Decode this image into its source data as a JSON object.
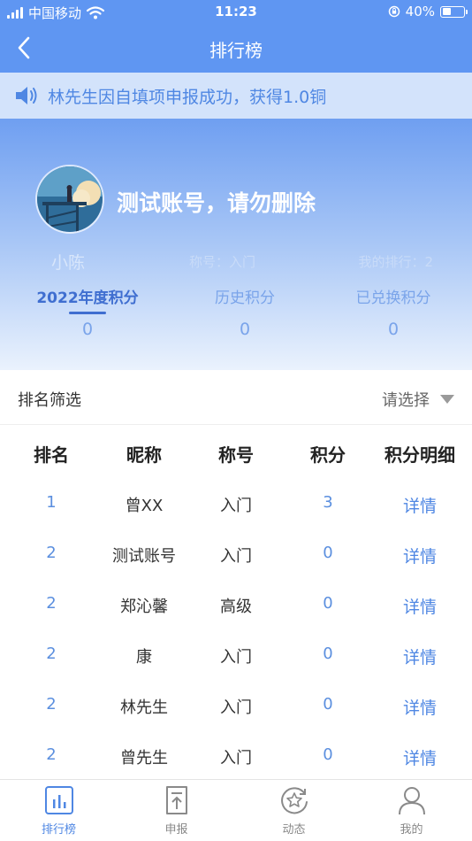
{
  "status_bar": {
    "carrier": "中国移动",
    "time": "11:23",
    "battery": "40%"
  },
  "header": {
    "title": "排行榜"
  },
  "notice": {
    "text": "林先生因自填项申报成功，获得1.0铜"
  },
  "profile": {
    "account_name": "测试账号，请勿删除",
    "nickname": "小陈",
    "title_label": "称号：入门",
    "rank_label": "我的排行：2",
    "tabs": [
      {
        "label": "2022年度积分",
        "value": "0"
      },
      {
        "label": "历史积分",
        "value": "0"
      },
      {
        "label": "已兑换积分",
        "value": "0"
      }
    ]
  },
  "filter": {
    "label": "排名筛选",
    "placeholder": "请选择"
  },
  "table": {
    "headers": [
      "排名",
      "昵称",
      "称号",
      "积分",
      "积分明细"
    ],
    "rows": [
      {
        "rank": "1",
        "nickname": "曾XX",
        "title": "入门",
        "points": "3",
        "detail": "详情"
      },
      {
        "rank": "2",
        "nickname": "测试账号",
        "title": "入门",
        "points": "0",
        "detail": "详情"
      },
      {
        "rank": "2",
        "nickname": "郑沁馨",
        "title": "高级",
        "points": "0",
        "detail": "详情"
      },
      {
        "rank": "2",
        "nickname": "康",
        "title": "入门",
        "points": "0",
        "detail": "详情"
      },
      {
        "rank": "2",
        "nickname": "林先生",
        "title": "入门",
        "points": "0",
        "detail": "详情"
      },
      {
        "rank": "2",
        "nickname": "曾先生",
        "title": "入门",
        "points": "0",
        "detail": "详情"
      }
    ]
  },
  "tabbar": [
    {
      "label": "排行榜",
      "icon": "bar-chart-icon"
    },
    {
      "label": "申报",
      "icon": "upload-doc-icon"
    },
    {
      "label": "动态",
      "icon": "star-circle-icon"
    },
    {
      "label": "我的",
      "icon": "person-icon"
    }
  ],
  "colors": {
    "primary": "#5f96f2",
    "accent": "#4f87e3",
    "notice_bg": "#d3e3fb"
  }
}
